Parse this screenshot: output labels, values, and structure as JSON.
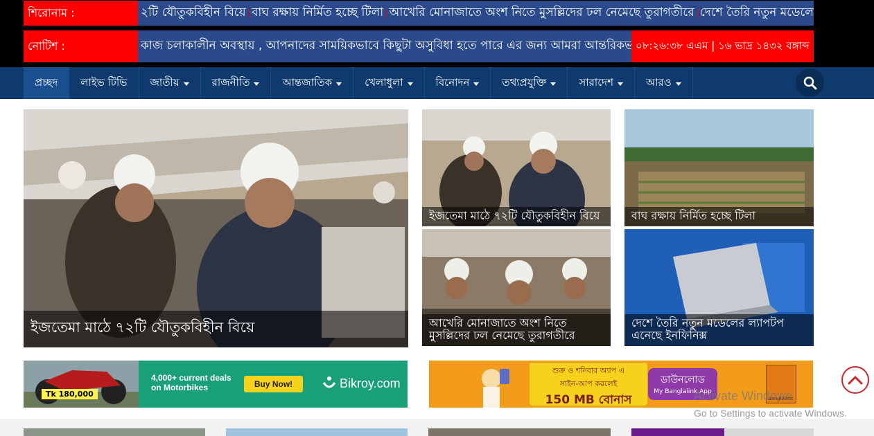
{
  "ticker": {
    "headline_label": "শিরোনাম :",
    "headlines": [
      "২টি যৌতুকবিহীন বিয়ে",
      "বাঘ রক্ষায় নির্মিত হচ্ছে টিলা",
      "আখেরি মোনাজাতে অংশ নিতে মুসল্লিদের ঢল নেমেছে তুরাগতীরে",
      "দেশে তৈরি নতুন মডেলে"
    ],
    "notice_label": "নোটিশ :",
    "notice_text": "কাজ চলাকালীন অবস্থায় , আপনাদের সাময়িকভাবে কিছুটা অসুবিধা হতে পারে এর জন্য আমরা আন্তরিকভাবে দু",
    "clock": "০৮:২৬:৩৮ এএম | ১৬ ভাদ্র ১৪৩২ বঙ্গাব্দ"
  },
  "nav": {
    "items": [
      {
        "label": "প্রচ্ছদ"
      },
      {
        "label": "লাইভ টিভি"
      },
      {
        "label": "জাতীয়"
      },
      {
        "label": "রাজনীতি"
      },
      {
        "label": "আন্তজাতিক"
      },
      {
        "label": "খেলাধুলা"
      },
      {
        "label": "বিনোদন"
      },
      {
        "label": "তথ্যপ্রযুক্তি"
      },
      {
        "label": "সারাদেশ"
      },
      {
        "label": "আরও"
      }
    ],
    "search_icon": "search-icon"
  },
  "news": {
    "lead": {
      "title": "ইজতেমা মাঠে ৭২টি যৌতুকবিহীন বিয়ে"
    },
    "tiles": [
      {
        "title": "ইজতেমা মাঠে ৭২টি যৌতুকবিহীন বিয়ে"
      },
      {
        "title": "বাঘ রক্ষায় নির্মিত হচ্ছে টিলা"
      },
      {
        "title": "আখেরি মোনাজাতে অংশ নিতে মুসল্লিদের ঢল নেমেছে তুরাগতীরে"
      },
      {
        "title": "দেশে তৈরি নতুন মডেলের ল্যাপটপ এনেছে ইনফিনিক্স"
      }
    ]
  },
  "ads": {
    "bikroy": {
      "price": "Tk 180,000",
      "deals": "4,000+ current deals",
      "deals2": "on Motorbikes",
      "button": "Buy Now!",
      "brand": "Bikroy.com"
    },
    "banglalink": {
      "line1": "শুক্র ও শনিবার অ্যাপ এ",
      "line2": "সাইন-আপ করলেই",
      "line3": "150 MB বোনাস",
      "button": "ডাউনলোড",
      "button_sub": "My Banglalink App",
      "brand": "banglalink"
    }
  },
  "os": {
    "activate_title": "Activate Windows",
    "activate_sub": "Go to Settings to activate Windows."
  },
  "colors": {
    "ticker_red": "#ff0000",
    "ticker_blue": "#2a4a8c",
    "nav_bg": "#0e3a6e",
    "accent_red": "#c62828"
  }
}
